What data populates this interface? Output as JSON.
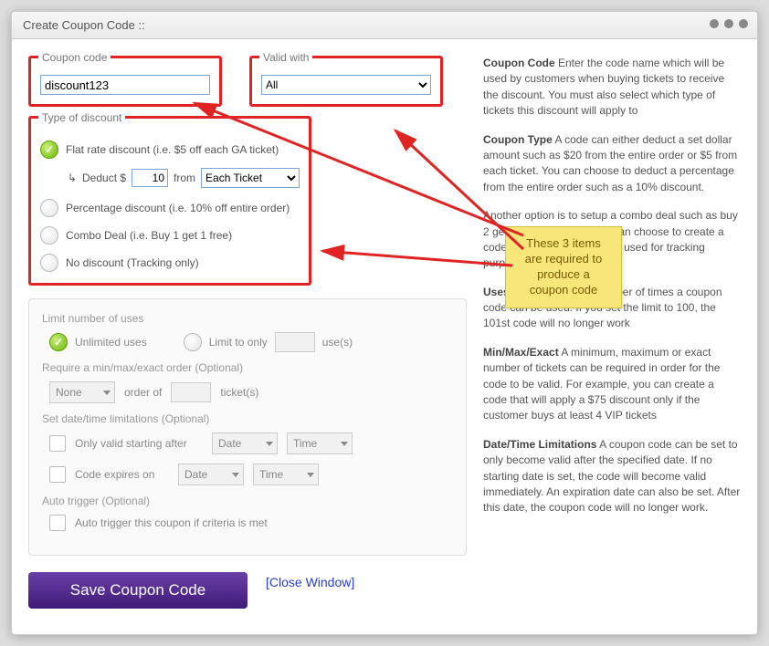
{
  "title": "Create Coupon Code ::",
  "coupon": {
    "legend": "Coupon code",
    "value": "discount123"
  },
  "valid": {
    "legend": "Valid with",
    "selected": "All"
  },
  "discount": {
    "legend": "Type of discount",
    "flat": {
      "label": "Flat rate discount (i.e. $5 off each GA ticket)",
      "checked": true
    },
    "deduct": {
      "prefix": "Deduct $",
      "amount": "10",
      "from_label": "from",
      "scope": "Each Ticket"
    },
    "percent": {
      "label": "Percentage discount (i.e. 10% off entire order)",
      "checked": false
    },
    "combo": {
      "label": "Combo Deal (i.e. Buy 1 get 1 free)",
      "checked": false
    },
    "none": {
      "label": "No discount (Tracking only)",
      "checked": false
    }
  },
  "limits": {
    "section": "Limit number of uses",
    "unlimited": {
      "label": "Unlimited uses",
      "checked": true
    },
    "limit_to": {
      "label": "Limit to only",
      "suffix": "use(s)",
      "value": ""
    }
  },
  "requireOrder": {
    "section": "Require a min/max/exact order (Optional)",
    "mode": "None",
    "middle": "order of",
    "suffix": "ticket(s)",
    "value": ""
  },
  "dateLimits": {
    "section": "Set date/time limitations (Optional)",
    "start": {
      "label": "Only valid starting after",
      "date_ph": "Date",
      "time_ph": "Time"
    },
    "end": {
      "label": "Code expires on",
      "date_ph": "Date",
      "time_ph": "Time"
    }
  },
  "autoTrigger": {
    "section": "Auto trigger (Optional)",
    "label": "Auto trigger this coupon if criteria is met"
  },
  "actions": {
    "save": "Save Coupon Code",
    "close": "[Close Window]"
  },
  "note": "These 3 items are required to produce a coupon code",
  "help": {
    "code": {
      "title": "Coupon Code",
      "body": " Enter the code name which will be used by customers when buying tickets to receive the discount. You must also select which type of tickets this discount will apply to"
    },
    "type": {
      "title": "Coupon Type",
      "body": " A code can either deduct a set dollar amount such as $20 from the entire order or $5 from each ticket. You can choose to deduct a percentage from the entire order such as a 10% discount."
    },
    "type2": "Another option is to setup a combo deal such as buy 2 get 1 half off. Lastly, you can choose to create a code with no discount and is used for tracking purposes",
    "uses": {
      "title": "Uses",
      "body": " You can limit the number of times a coupon code can be used. If you set the limit to 100, the 101st code will no longer work"
    },
    "mme": {
      "title": "Min/Max/Exact",
      "body": " A minimum, maximum or exact number of tickets can be required in order for the code to be valid. For example, you can create a code that will apply a $75 discount only if the customer buys at least 4 VIP tickets"
    },
    "dt": {
      "title": "Date/Time Limitations",
      "body": " A coupon code can be set to only become valid after the specified date. If no starting date is set, the code will become valid immediately. An expiration date can also be set. After this date, the coupon code will no longer work."
    }
  }
}
